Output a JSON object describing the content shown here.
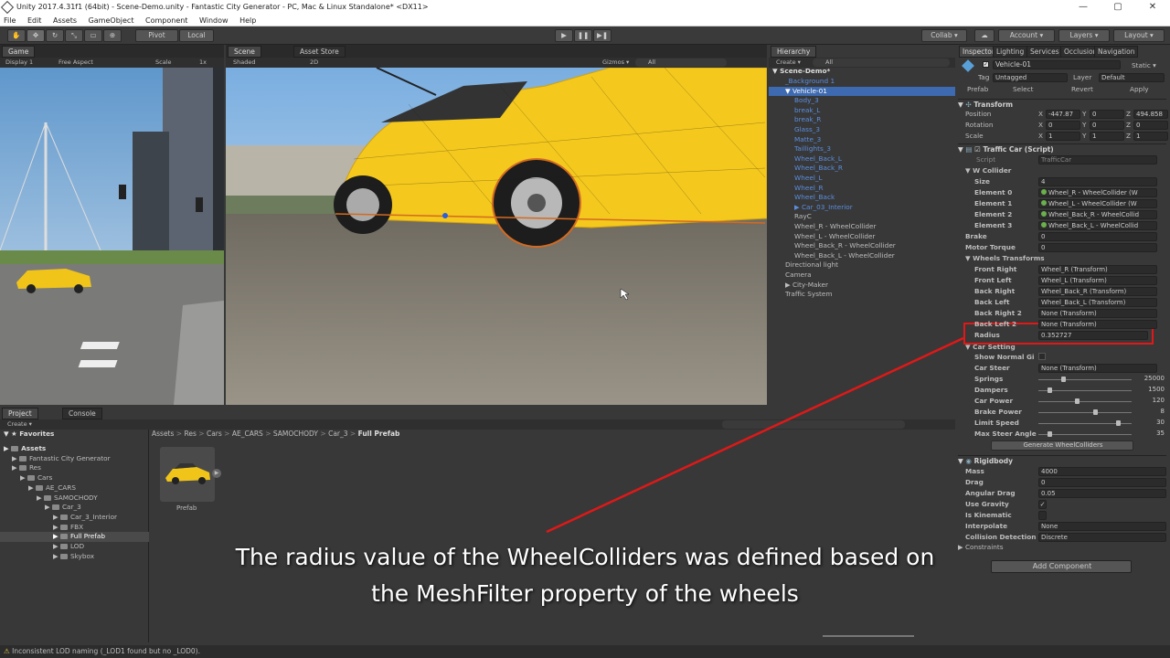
{
  "window": {
    "title": "Unity 2017.4.31f1 (64bit) - Scene-Demo.unity - Fantastic City Generator - PC, Mac & Linux Standalone* <DX11>",
    "minimize": "—",
    "maximize": "▢",
    "close": "✕"
  },
  "menu": [
    "File",
    "Edit",
    "Assets",
    "GameObject",
    "Component",
    "Window",
    "Help"
  ],
  "toolbar": {
    "pivot": "Pivot",
    "local": "Local",
    "collab": "Collab ▾",
    "account": "Account ▾",
    "layers": "Layers ▾",
    "layout": "Layout ▾"
  },
  "game": {
    "tab": "Game",
    "display": "Display 1",
    "aspect": "Free Aspect",
    "scale": "Scale",
    "scale_val": "1x"
  },
  "scene": {
    "tab": "Scene",
    "asset_store": "Asset Store",
    "shaded": "Shaded",
    "mode2d": "2D",
    "gizmos": "Gizmos ▾",
    "search": "All"
  },
  "hierarchy": {
    "tab": "Hierarchy",
    "create": "Create ▾",
    "search": "All",
    "scene_name": "Scene-Demo*",
    "items": [
      {
        "label": "_Background 1",
        "indent": 1,
        "blue": true
      },
      {
        "label": "Vehicle-01",
        "indent": 1,
        "blue": false,
        "selected": true
      },
      {
        "label": "Body_3",
        "indent": 2,
        "blue": true
      },
      {
        "label": "break_L",
        "indent": 2,
        "blue": true
      },
      {
        "label": "break_R",
        "indent": 2,
        "blue": true
      },
      {
        "label": "Glass_3",
        "indent": 2,
        "blue": true
      },
      {
        "label": "Matte_3",
        "indent": 2,
        "blue": true
      },
      {
        "label": "Taillights_3",
        "indent": 2,
        "blue": true
      },
      {
        "label": "Wheel_Back_L",
        "indent": 2,
        "blue": true
      },
      {
        "label": "Wheel_Back_R",
        "indent": 2,
        "blue": true
      },
      {
        "label": "Wheel_L",
        "indent": 2,
        "blue": true
      },
      {
        "label": "Wheel_R",
        "indent": 2,
        "blue": true
      },
      {
        "label": "Wheel_Back",
        "indent": 2,
        "blue": true
      },
      {
        "label": "Car_03_Interior",
        "indent": 2,
        "blue": true,
        "arrow": true
      },
      {
        "label": "RayC",
        "indent": 2,
        "blue": false
      },
      {
        "label": "Wheel_R - WheelCollider",
        "indent": 2,
        "blue": false
      },
      {
        "label": "Wheel_L - WheelCollider",
        "indent": 2,
        "blue": false
      },
      {
        "label": "Wheel_Back_R - WheelCollider",
        "indent": 2,
        "blue": false
      },
      {
        "label": "Wheel_Back_L - WheelCollider",
        "indent": 2,
        "blue": false
      },
      {
        "label": "Directional light",
        "indent": 1,
        "blue": false
      },
      {
        "label": "Camera",
        "indent": 1,
        "blue": false
      },
      {
        "label": "City-Maker",
        "indent": 1,
        "blue": false,
        "arrow": true
      },
      {
        "label": "Traffic System",
        "indent": 1,
        "blue": false
      }
    ]
  },
  "inspector": {
    "tabs": [
      "Inspector",
      "Lighting",
      "Services",
      "Occlusion",
      "Navigation"
    ],
    "object_name": "Vehicle-01",
    "static": "Static ▾",
    "tag_label": "Tag",
    "tag": "Untagged",
    "layer_label": "Layer",
    "layer": "Default",
    "prefab_label": "Prefab",
    "select": "Select",
    "revert": "Revert",
    "apply": "Apply",
    "transform": {
      "title": "Transform",
      "rows": [
        {
          "label": "Position",
          "x": "-447.87",
          "y": "0",
          "z": "494.858"
        },
        {
          "label": "Rotation",
          "x": "0",
          "y": "0",
          "z": "0"
        },
        {
          "label": "Scale",
          "x": "1",
          "y": "1",
          "z": "1"
        }
      ]
    },
    "traffic_car": {
      "title": "Traffic Car (Script)",
      "script_label": "Script",
      "script": "TrafficCar",
      "w_collider": "W Collider",
      "size_label": "Size",
      "size": "4",
      "elements": [
        {
          "label": "Element 0",
          "value": "Wheel_R - WheelCollider (W"
        },
        {
          "label": "Element 1",
          "value": "Wheel_L - WheelCollider (W"
        },
        {
          "label": "Element 2",
          "value": "Wheel_Back_R - WheelCollid"
        },
        {
          "label": "Element 3",
          "value": "Wheel_Back_L - WheelCollid"
        }
      ],
      "brake_label": "Brake",
      "brake": "0",
      "torque_label": "Motor Torque",
      "torque": "0",
      "wheels_transforms": "Wheels Transforms",
      "wheels": [
        {
          "label": "Front Right",
          "value": "Wheel_R (Transform)"
        },
        {
          "label": "Front Left",
          "value": "Wheel_L (Transform)"
        },
        {
          "label": "Back Right",
          "value": "Wheel_Back_R (Transform)"
        },
        {
          "label": "Back Left",
          "value": "Wheel_Back_L (Transform)"
        },
        {
          "label": "Back Right 2",
          "value": "None (Transform)"
        },
        {
          "label": "Back Left 2",
          "value": "None (Transform)"
        }
      ],
      "radius_label": "Radius",
      "radius": "0.352727",
      "car_setting": "Car Setting",
      "show_normal_label": "Show Normal Gi",
      "car_steer_label": "Car Steer",
      "car_steer": "None (Transform)",
      "sliders": [
        {
          "label": "Springs",
          "value": "25000",
          "level": 0.25
        },
        {
          "label": "Dampers",
          "value": "1500",
          "level": 0.1
        },
        {
          "label": "Car Power",
          "value": "120",
          "level": 0.4
        },
        {
          "label": "Brake Power",
          "value": "8",
          "level": 0.6
        },
        {
          "label": "Limit Speed",
          "value": "30",
          "level": 0.85
        },
        {
          "label": "Max Steer Angle",
          "value": "35",
          "level": 0.1
        }
      ],
      "generate": "Generate WheelColliders"
    },
    "rigidbody": {
      "title": "Rigidbody",
      "rows": [
        {
          "label": "Mass",
          "value": "4000"
        },
        {
          "label": "Drag",
          "value": "0"
        },
        {
          "label": "Angular Drag",
          "value": "0.05"
        },
        {
          "label": "Use Gravity",
          "value": "✓"
        },
        {
          "label": "Is Kinematic",
          "value": ""
        },
        {
          "label": "Interpolate",
          "value": "None"
        },
        {
          "label": "Collision Detection",
          "value": "Discrete"
        }
      ],
      "constraints": "Constraints"
    },
    "add_component": "Add Component"
  },
  "project": {
    "tab": "Project",
    "console_tab": "Console",
    "create": "Create ▾",
    "breadcrumb": [
      "Assets",
      "Res",
      "Cars",
      "AE_CARS",
      "SAMOCHODY",
      "Car_3",
      "Full Prefab"
    ],
    "favorites": "Favorites",
    "tree": [
      {
        "label": "Assets",
        "indent": 0,
        "bold": true
      },
      {
        "label": "Fantastic City Generator",
        "indent": 1
      },
      {
        "label": "Res",
        "indent": 1
      },
      {
        "label": "Cars",
        "indent": 2
      },
      {
        "label": "AE_CARS",
        "indent": 3
      },
      {
        "label": "SAMOCHODY",
        "indent": 4
      },
      {
        "label": "Car_3",
        "indent": 5
      },
      {
        "label": "Car_3_Interior",
        "indent": 6
      },
      {
        "label": "FBX",
        "indent": 6
      },
      {
        "label": "Full Prefab",
        "indent": 6,
        "selected": true
      },
      {
        "label": "LOD",
        "indent": 6
      },
      {
        "label": "Skybox",
        "indent": 6
      }
    ],
    "asset_label": "Prefab"
  },
  "status": "Inconsistent LOD naming (_LOD1 found but no _LOD0).",
  "caption": {
    "line1": "The radius value of the WheelColliders was defined based on",
    "line2": "the MeshFilter property of the wheels"
  },
  "colors": {
    "highlight": "#e01818",
    "selection": "#3d6ab0"
  }
}
